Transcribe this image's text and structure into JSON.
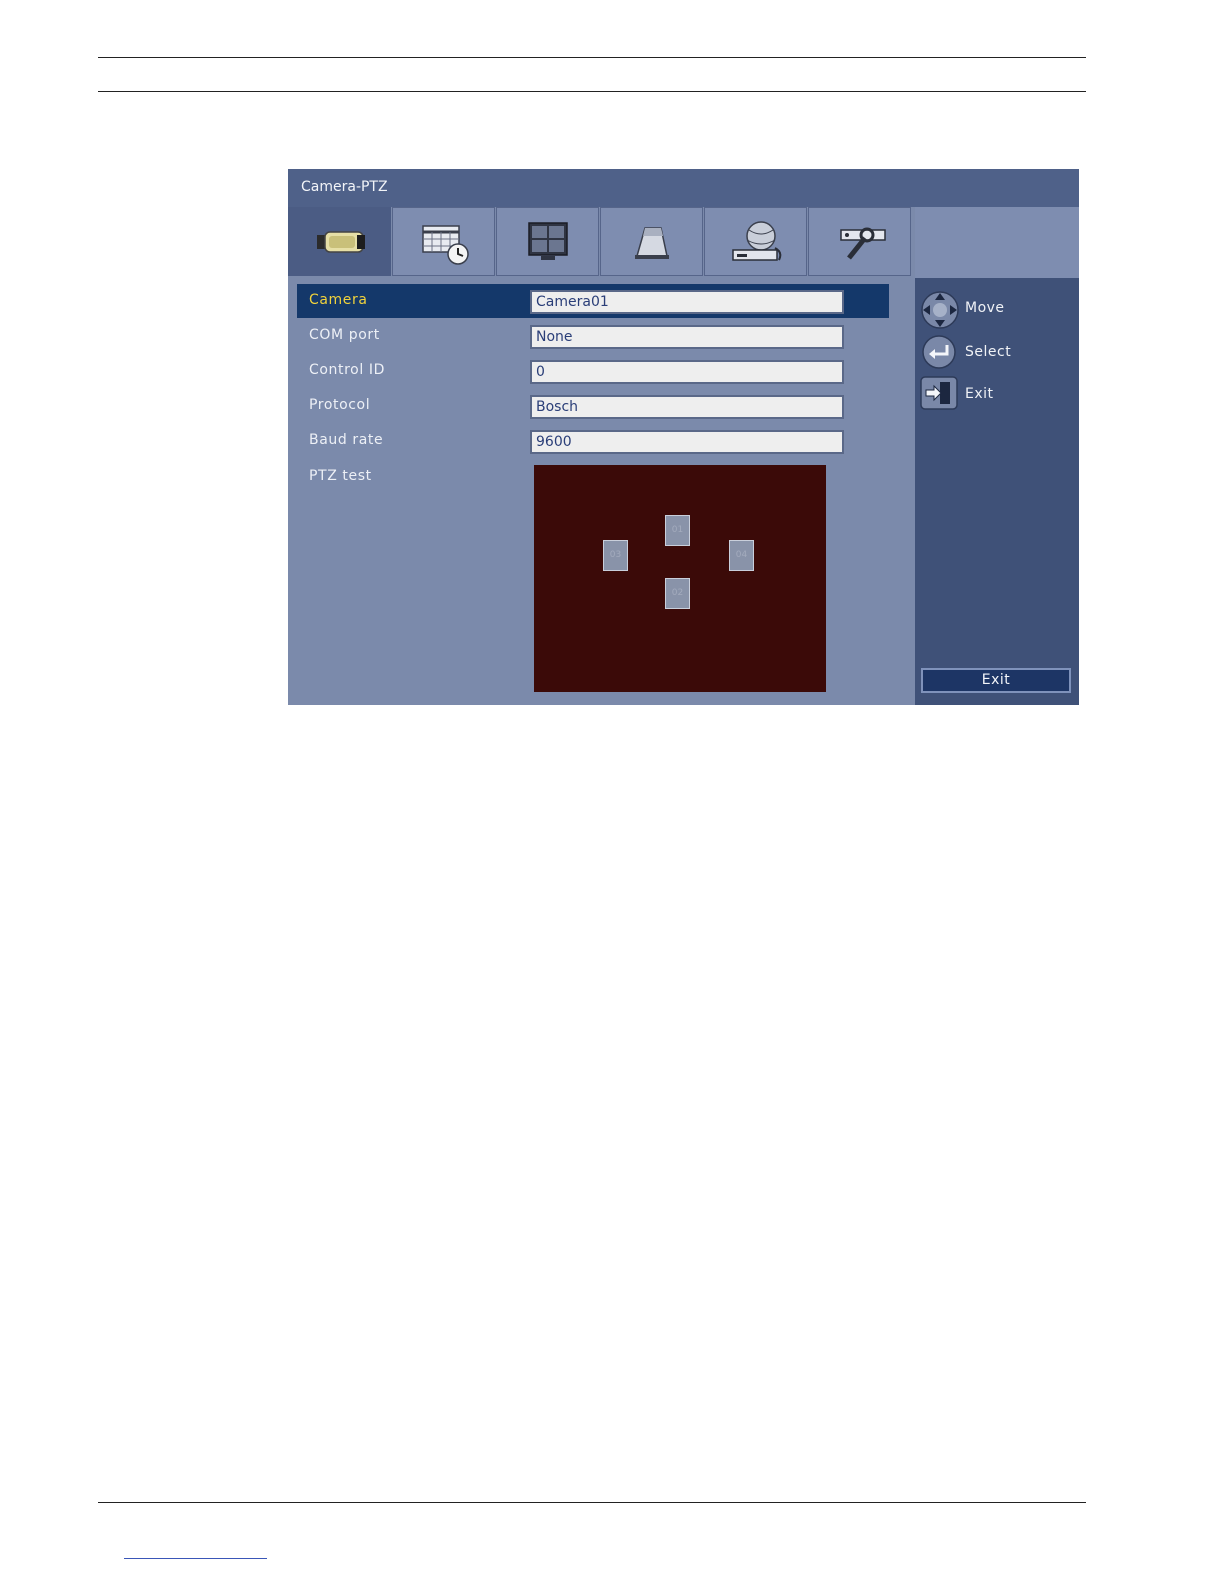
{
  "window": {
    "title": "Camera-PTZ"
  },
  "tabs": [
    {
      "icon": "camera-icon",
      "active": true
    },
    {
      "icon": "schedule-icon",
      "active": false
    },
    {
      "icon": "monitor-layout-icon",
      "active": false
    },
    {
      "icon": "alarm-icon",
      "active": false
    },
    {
      "icon": "network-icon",
      "active": false
    },
    {
      "icon": "tools-icon",
      "active": false
    }
  ],
  "form": {
    "camera": {
      "label": "Camera",
      "value": "Camera01"
    },
    "com_port": {
      "label": "COM port",
      "value": "None"
    },
    "control_id": {
      "label": "Control ID",
      "value": "0"
    },
    "protocol": {
      "label": "Protocol",
      "value": "Bosch"
    },
    "baud_rate": {
      "label": "Baud rate",
      "value": "9600"
    },
    "ptz_test": {
      "label": "PTZ test"
    }
  },
  "ptz_pad": {
    "up": "01",
    "down": "02",
    "left": "03",
    "right": "04"
  },
  "help": {
    "move": {
      "icon": "dpad-icon",
      "label": "Move"
    },
    "select": {
      "icon": "enter-icon",
      "label": "Select"
    },
    "exit": {
      "icon": "exit-door-icon",
      "label": "Exit"
    }
  },
  "exit_button": {
    "label": "Exit"
  },
  "colors": {
    "title_bar": "#4f6189",
    "panel": "#7b8aab",
    "side_panel": "#3f5178",
    "selected_row": "#14386a",
    "selected_label": "#f0d23c",
    "ptz_area": "#3b0a08"
  }
}
